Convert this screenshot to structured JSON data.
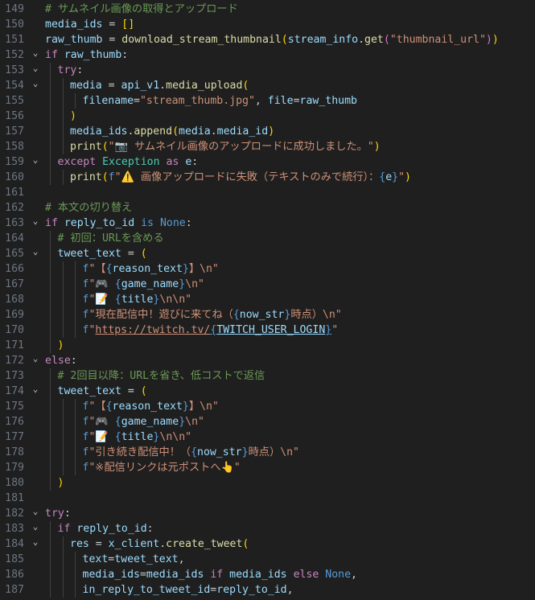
{
  "editor": {
    "language": "python",
    "theme_colors": {
      "background": "#1f1f1f",
      "keyword": "#c586c0",
      "function": "#dcdcaa",
      "variable": "#9cdcfe",
      "string": "#ce9178",
      "comment": "#6a9955"
    },
    "lines": [
      {
        "num": "149",
        "indent": 1,
        "fold": false,
        "t": [
          [
            "cmt",
            "# サムネイル画像の取得とアップロード"
          ]
        ]
      },
      {
        "num": "150",
        "indent": 1,
        "fold": false,
        "t": [
          [
            "var",
            "media_ids"
          ],
          [
            "plain",
            " = "
          ],
          [
            "b1",
            "[]"
          ]
        ]
      },
      {
        "num": "151",
        "indent": 1,
        "fold": false,
        "t": [
          [
            "var",
            "raw_thumb"
          ],
          [
            "plain",
            " = "
          ],
          [
            "fn",
            "download_stream_thumbnail"
          ],
          [
            "b1",
            "("
          ],
          [
            "var",
            "stream_info"
          ],
          [
            "plain",
            "."
          ],
          [
            "fn",
            "get"
          ],
          [
            "b2",
            "("
          ],
          [
            "str",
            "\"thumbnail_url\""
          ],
          [
            "b2",
            ")"
          ],
          [
            "b1",
            ")"
          ]
        ]
      },
      {
        "num": "152",
        "indent": 1,
        "fold": true,
        "t": [
          [
            "kw",
            "if "
          ],
          [
            "var",
            "raw_thumb"
          ],
          [
            "plain",
            ":"
          ]
        ]
      },
      {
        "num": "153",
        "indent": 2,
        "fold": true,
        "t": [
          [
            "kw",
            "try"
          ],
          [
            "plain",
            ":"
          ]
        ]
      },
      {
        "num": "154",
        "indent": 3,
        "fold": true,
        "t": [
          [
            "var",
            "media"
          ],
          [
            "plain",
            " = "
          ],
          [
            "var",
            "api_v1"
          ],
          [
            "plain",
            "."
          ],
          [
            "fn",
            "media_upload"
          ],
          [
            "b1",
            "("
          ]
        ]
      },
      {
        "num": "155",
        "indent": 4,
        "fold": false,
        "t": [
          [
            "var",
            "filename"
          ],
          [
            "plain",
            "="
          ],
          [
            "str",
            "\"stream_thumb.jpg\""
          ],
          [
            "plain",
            ", "
          ],
          [
            "var",
            "file"
          ],
          [
            "plain",
            "="
          ],
          [
            "var",
            "raw_thumb"
          ]
        ]
      },
      {
        "num": "156",
        "indent": 3,
        "fold": false,
        "t": [
          [
            "b1",
            ")"
          ]
        ]
      },
      {
        "num": "157",
        "indent": 3,
        "fold": false,
        "t": [
          [
            "var",
            "media_ids"
          ],
          [
            "plain",
            "."
          ],
          [
            "fn",
            "append"
          ],
          [
            "b1",
            "("
          ],
          [
            "var",
            "media"
          ],
          [
            "plain",
            "."
          ],
          [
            "var",
            "media_id"
          ],
          [
            "b1",
            ")"
          ]
        ]
      },
      {
        "num": "158",
        "indent": 3,
        "fold": false,
        "t": [
          [
            "fn",
            "print"
          ],
          [
            "b1",
            "("
          ],
          [
            "str",
            "\"📷 サムネイル画像のアップロードに成功しました。\""
          ],
          [
            "b1",
            ")"
          ]
        ]
      },
      {
        "num": "159",
        "indent": 2,
        "fold": true,
        "t": [
          [
            "kw",
            "except "
          ],
          [
            "cls",
            "Exception"
          ],
          [
            "kw",
            " as "
          ],
          [
            "var",
            "e"
          ],
          [
            "plain",
            ":"
          ]
        ]
      },
      {
        "num": "160",
        "indent": 3,
        "fold": false,
        "t": [
          [
            "fn",
            "print"
          ],
          [
            "b1",
            "("
          ],
          [
            "kw2",
            "f"
          ],
          [
            "str",
            "\"⚠️ 画像アップロードに失敗（テキストのみで続行）："
          ],
          [
            "kw2",
            "{"
          ],
          [
            "var",
            "e"
          ],
          [
            "kw2",
            "}"
          ],
          [
            "str",
            "\""
          ],
          [
            "b1",
            ")"
          ]
        ]
      },
      {
        "num": "161",
        "indent": 0,
        "fold": false,
        "t": []
      },
      {
        "num": "162",
        "indent": 1,
        "fold": false,
        "t": [
          [
            "cmt",
            "# 本文の切り替え"
          ]
        ]
      },
      {
        "num": "163",
        "indent": 1,
        "fold": true,
        "t": [
          [
            "kw",
            "if "
          ],
          [
            "var",
            "reply_to_id"
          ],
          [
            "kw2",
            " is "
          ],
          [
            "kw2",
            "None"
          ],
          [
            "plain",
            ":"
          ]
        ]
      },
      {
        "num": "164",
        "indent": 2,
        "fold": false,
        "t": [
          [
            "cmt",
            "# 初回：URLを含める"
          ]
        ]
      },
      {
        "num": "165",
        "indent": 2,
        "fold": true,
        "t": [
          [
            "var",
            "tweet_text"
          ],
          [
            "plain",
            " = "
          ],
          [
            "b1",
            "("
          ]
        ]
      },
      {
        "num": "166",
        "indent": 4,
        "fold": false,
        "t": [
          [
            "kw2",
            "f"
          ],
          [
            "str",
            "\"【"
          ],
          [
            "kw2",
            "{"
          ],
          [
            "var",
            "reason_text"
          ],
          [
            "kw2",
            "}"
          ],
          [
            "str",
            "】\\n\""
          ]
        ]
      },
      {
        "num": "167",
        "indent": 4,
        "fold": false,
        "t": [
          [
            "kw2",
            "f"
          ],
          [
            "str",
            "\"🎮 "
          ],
          [
            "kw2",
            "{"
          ],
          [
            "var",
            "game_name"
          ],
          [
            "kw2",
            "}"
          ],
          [
            "str",
            "\\n\""
          ]
        ]
      },
      {
        "num": "168",
        "indent": 4,
        "fold": false,
        "t": [
          [
            "kw2",
            "f"
          ],
          [
            "str",
            "\"📝 "
          ],
          [
            "kw2",
            "{"
          ],
          [
            "var",
            "title"
          ],
          [
            "kw2",
            "}"
          ],
          [
            "str",
            "\\n\\n\""
          ]
        ]
      },
      {
        "num": "169",
        "indent": 4,
        "fold": false,
        "t": [
          [
            "kw2",
            "f"
          ],
          [
            "str",
            "\"現在配信中！遊びに来てね（"
          ],
          [
            "kw2",
            "{"
          ],
          [
            "var",
            "now_str"
          ],
          [
            "kw2",
            "}"
          ],
          [
            "str",
            "時点）\\n\""
          ]
        ]
      },
      {
        "num": "170",
        "indent": 4,
        "fold": false,
        "t": [
          [
            "kw2",
            "f"
          ],
          [
            "str",
            "\""
          ],
          [
            "stru",
            "https://twitch.tv/"
          ],
          [
            "kw2u",
            "{"
          ],
          [
            "varu",
            "TWITCH_USER_LOGIN"
          ],
          [
            "kw2u",
            "}"
          ],
          [
            "str",
            "\""
          ]
        ]
      },
      {
        "num": "171",
        "indent": 2,
        "fold": false,
        "t": [
          [
            "b1",
            ")"
          ]
        ]
      },
      {
        "num": "172",
        "indent": 1,
        "fold": true,
        "t": [
          [
            "kw",
            "else"
          ],
          [
            "plain",
            ":"
          ]
        ]
      },
      {
        "num": "173",
        "indent": 2,
        "fold": false,
        "t": [
          [
            "cmt",
            "# 2回目以降：URLを省き、低コストで返信"
          ]
        ]
      },
      {
        "num": "174",
        "indent": 2,
        "fold": true,
        "t": [
          [
            "var",
            "tweet_text"
          ],
          [
            "plain",
            " = "
          ],
          [
            "b1",
            "("
          ]
        ]
      },
      {
        "num": "175",
        "indent": 4,
        "fold": false,
        "t": [
          [
            "kw2",
            "f"
          ],
          [
            "str",
            "\"【"
          ],
          [
            "kw2",
            "{"
          ],
          [
            "var",
            "reason_text"
          ],
          [
            "kw2",
            "}"
          ],
          [
            "str",
            "】\\n\""
          ]
        ]
      },
      {
        "num": "176",
        "indent": 4,
        "fold": false,
        "t": [
          [
            "kw2",
            "f"
          ],
          [
            "str",
            "\"🎮 "
          ],
          [
            "kw2",
            "{"
          ],
          [
            "var",
            "game_name"
          ],
          [
            "kw2",
            "}"
          ],
          [
            "str",
            "\\n\""
          ]
        ]
      },
      {
        "num": "177",
        "indent": 4,
        "fold": false,
        "t": [
          [
            "kw2",
            "f"
          ],
          [
            "str",
            "\"📝 "
          ],
          [
            "kw2",
            "{"
          ],
          [
            "var",
            "title"
          ],
          [
            "kw2",
            "}"
          ],
          [
            "str",
            "\\n\\n\""
          ]
        ]
      },
      {
        "num": "178",
        "indent": 4,
        "fold": false,
        "t": [
          [
            "kw2",
            "f"
          ],
          [
            "str",
            "\"引き続き配信中！（"
          ],
          [
            "kw2",
            "{"
          ],
          [
            "var",
            "now_str"
          ],
          [
            "kw2",
            "}"
          ],
          [
            "str",
            "時点）\\n\""
          ]
        ]
      },
      {
        "num": "179",
        "indent": 4,
        "fold": false,
        "t": [
          [
            "kw2",
            "f"
          ],
          [
            "str",
            "\"※配信リンクは元ポストへ👆\""
          ]
        ]
      },
      {
        "num": "180",
        "indent": 2,
        "fold": false,
        "t": [
          [
            "b1",
            ")"
          ]
        ]
      },
      {
        "num": "181",
        "indent": 0,
        "fold": false,
        "t": []
      },
      {
        "num": "182",
        "indent": 1,
        "fold": true,
        "t": [
          [
            "kw",
            "try"
          ],
          [
            "plain",
            ":"
          ]
        ]
      },
      {
        "num": "183",
        "indent": 2,
        "fold": true,
        "t": [
          [
            "kw",
            "if "
          ],
          [
            "var",
            "reply_to_id"
          ],
          [
            "plain",
            ":"
          ]
        ]
      },
      {
        "num": "184",
        "indent": 3,
        "fold": true,
        "t": [
          [
            "var",
            "res"
          ],
          [
            "plain",
            " = "
          ],
          [
            "var",
            "x_client"
          ],
          [
            "plain",
            "."
          ],
          [
            "fn",
            "create_tweet"
          ],
          [
            "b1",
            "("
          ]
        ]
      },
      {
        "num": "185",
        "indent": 4,
        "fold": false,
        "t": [
          [
            "var",
            "text"
          ],
          [
            "plain",
            "="
          ],
          [
            "var",
            "tweet_text"
          ],
          [
            "plain",
            ","
          ]
        ]
      },
      {
        "num": "186",
        "indent": 4,
        "fold": false,
        "t": [
          [
            "var",
            "media_ids"
          ],
          [
            "plain",
            "="
          ],
          [
            "var",
            "media_ids"
          ],
          [
            "kw",
            " if "
          ],
          [
            "var",
            "media_ids"
          ],
          [
            "kw",
            " else "
          ],
          [
            "kw2",
            "None"
          ],
          [
            "plain",
            ","
          ]
        ]
      },
      {
        "num": "187",
        "indent": 4,
        "fold": false,
        "t": [
          [
            "var",
            "in_reply_to_tweet_id"
          ],
          [
            "plain",
            "="
          ],
          [
            "var",
            "reply_to_id"
          ],
          [
            "plain",
            ","
          ]
        ]
      }
    ]
  }
}
